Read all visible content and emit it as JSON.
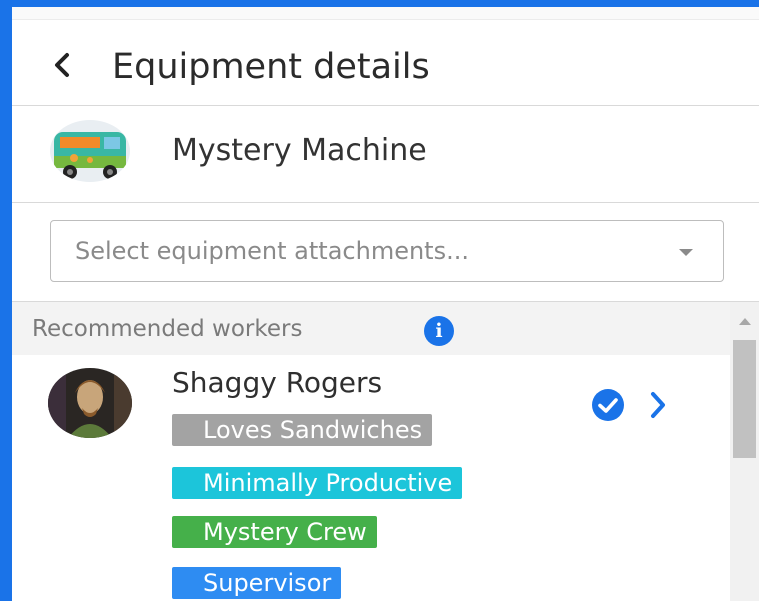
{
  "header": {
    "title": "Equipment details",
    "back_icon": "chevron-left-icon"
  },
  "equipment": {
    "name": "Mystery Machine",
    "avatar": "van-avatar"
  },
  "attachments_select": {
    "placeholder": "Select equipment attachments..."
  },
  "recommended": {
    "title": "Recommended workers",
    "info_icon": "info-icon",
    "workers": [
      {
        "name": "Shaggy Rogers",
        "avatar": "worker-avatar",
        "selected": true,
        "tags": [
          {
            "label": "Loves Sandwiches",
            "color": "#a3a3a3"
          },
          {
            "label": "Minimally Productive",
            "color": "#1cc5da"
          },
          {
            "label": "Mystery Crew",
            "color": "#45b04a"
          },
          {
            "label": "Supervisor",
            "color": "#2e8cf2"
          }
        ]
      }
    ]
  },
  "colors": {
    "accent": "#1a73e8",
    "frame": "#1a73e8"
  }
}
